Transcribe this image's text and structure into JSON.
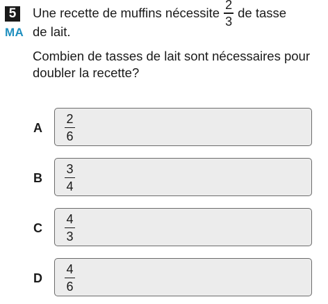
{
  "question": {
    "number": "5",
    "domain": "MA",
    "stem_prefix": "Une recette de muffins nécessite",
    "stem_fraction": {
      "numerator": "2",
      "denominator": "3"
    },
    "stem_suffix": "de tasse",
    "stem_line2": "de lait.",
    "prompt": "Combien de tasses de lait sont nécessaires pour doubler la recette?"
  },
  "choices": [
    {
      "letter": "A",
      "numerator": "2",
      "denominator": "6"
    },
    {
      "letter": "B",
      "numerator": "3",
      "denominator": "4"
    },
    {
      "letter": "C",
      "numerator": "4",
      "denominator": "3"
    },
    {
      "letter": "D",
      "numerator": "4",
      "denominator": "6"
    }
  ],
  "colors": {
    "domain_label": "#1f8fbf",
    "choice_background": "#ececec",
    "choice_border": "#6b6b6b"
  }
}
